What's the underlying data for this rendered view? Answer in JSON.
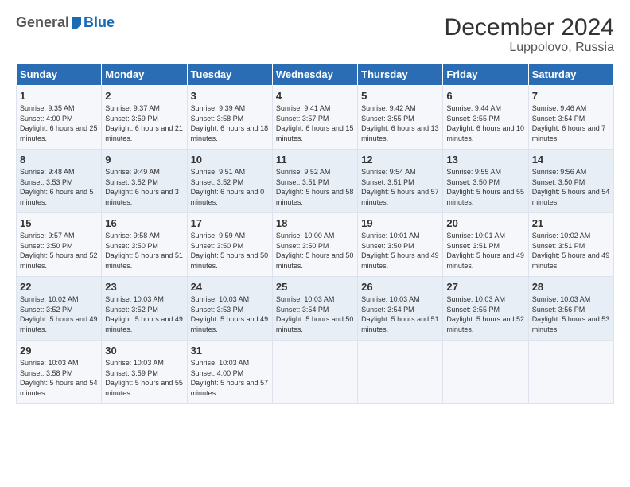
{
  "logo": {
    "general": "General",
    "blue": "Blue"
  },
  "title": "December 2024",
  "subtitle": "Luppolovo, Russia",
  "days_of_week": [
    "Sunday",
    "Monday",
    "Tuesday",
    "Wednesday",
    "Thursday",
    "Friday",
    "Saturday"
  ],
  "weeks": [
    [
      {
        "day": "1",
        "sunrise": "9:35 AM",
        "sunset": "4:00 PM",
        "daylight": "6 hours and 25 minutes."
      },
      {
        "day": "2",
        "sunrise": "9:37 AM",
        "sunset": "3:59 PM",
        "daylight": "6 hours and 21 minutes."
      },
      {
        "day": "3",
        "sunrise": "9:39 AM",
        "sunset": "3:58 PM",
        "daylight": "6 hours and 18 minutes."
      },
      {
        "day": "4",
        "sunrise": "9:41 AM",
        "sunset": "3:57 PM",
        "daylight": "6 hours and 15 minutes."
      },
      {
        "day": "5",
        "sunrise": "9:42 AM",
        "sunset": "3:55 PM",
        "daylight": "6 hours and 13 minutes."
      },
      {
        "day": "6",
        "sunrise": "9:44 AM",
        "sunset": "3:55 PM",
        "daylight": "6 hours and 10 minutes."
      },
      {
        "day": "7",
        "sunrise": "9:46 AM",
        "sunset": "3:54 PM",
        "daylight": "6 hours and 7 minutes."
      }
    ],
    [
      {
        "day": "8",
        "sunrise": "9:48 AM",
        "sunset": "3:53 PM",
        "daylight": "6 hours and 5 minutes."
      },
      {
        "day": "9",
        "sunrise": "9:49 AM",
        "sunset": "3:52 PM",
        "daylight": "6 hours and 3 minutes."
      },
      {
        "day": "10",
        "sunrise": "9:51 AM",
        "sunset": "3:52 PM",
        "daylight": "6 hours and 0 minutes."
      },
      {
        "day": "11",
        "sunrise": "9:52 AM",
        "sunset": "3:51 PM",
        "daylight": "5 hours and 58 minutes."
      },
      {
        "day": "12",
        "sunrise": "9:54 AM",
        "sunset": "3:51 PM",
        "daylight": "5 hours and 57 minutes."
      },
      {
        "day": "13",
        "sunrise": "9:55 AM",
        "sunset": "3:50 PM",
        "daylight": "5 hours and 55 minutes."
      },
      {
        "day": "14",
        "sunrise": "9:56 AM",
        "sunset": "3:50 PM",
        "daylight": "5 hours and 54 minutes."
      }
    ],
    [
      {
        "day": "15",
        "sunrise": "9:57 AM",
        "sunset": "3:50 PM",
        "daylight": "5 hours and 52 minutes."
      },
      {
        "day": "16",
        "sunrise": "9:58 AM",
        "sunset": "3:50 PM",
        "daylight": "5 hours and 51 minutes."
      },
      {
        "day": "17",
        "sunrise": "9:59 AM",
        "sunset": "3:50 PM",
        "daylight": "5 hours and 50 minutes."
      },
      {
        "day": "18",
        "sunrise": "10:00 AM",
        "sunset": "3:50 PM",
        "daylight": "5 hours and 50 minutes."
      },
      {
        "day": "19",
        "sunrise": "10:01 AM",
        "sunset": "3:50 PM",
        "daylight": "5 hours and 49 minutes."
      },
      {
        "day": "20",
        "sunrise": "10:01 AM",
        "sunset": "3:51 PM",
        "daylight": "5 hours and 49 minutes."
      },
      {
        "day": "21",
        "sunrise": "10:02 AM",
        "sunset": "3:51 PM",
        "daylight": "5 hours and 49 minutes."
      }
    ],
    [
      {
        "day": "22",
        "sunrise": "10:02 AM",
        "sunset": "3:52 PM",
        "daylight": "5 hours and 49 minutes."
      },
      {
        "day": "23",
        "sunrise": "10:03 AM",
        "sunset": "3:52 PM",
        "daylight": "5 hours and 49 minutes."
      },
      {
        "day": "24",
        "sunrise": "10:03 AM",
        "sunset": "3:53 PM",
        "daylight": "5 hours and 49 minutes."
      },
      {
        "day": "25",
        "sunrise": "10:03 AM",
        "sunset": "3:54 PM",
        "daylight": "5 hours and 50 minutes."
      },
      {
        "day": "26",
        "sunrise": "10:03 AM",
        "sunset": "3:54 PM",
        "daylight": "5 hours and 51 minutes."
      },
      {
        "day": "27",
        "sunrise": "10:03 AM",
        "sunset": "3:55 PM",
        "daylight": "5 hours and 52 minutes."
      },
      {
        "day": "28",
        "sunrise": "10:03 AM",
        "sunset": "3:56 PM",
        "daylight": "5 hours and 53 minutes."
      }
    ],
    [
      {
        "day": "29",
        "sunrise": "10:03 AM",
        "sunset": "3:58 PM",
        "daylight": "5 hours and 54 minutes."
      },
      {
        "day": "30",
        "sunrise": "10:03 AM",
        "sunset": "3:59 PM",
        "daylight": "5 hours and 55 minutes."
      },
      {
        "day": "31",
        "sunrise": "10:03 AM",
        "sunset": "4:00 PM",
        "daylight": "5 hours and 57 minutes."
      },
      null,
      null,
      null,
      null
    ]
  ]
}
